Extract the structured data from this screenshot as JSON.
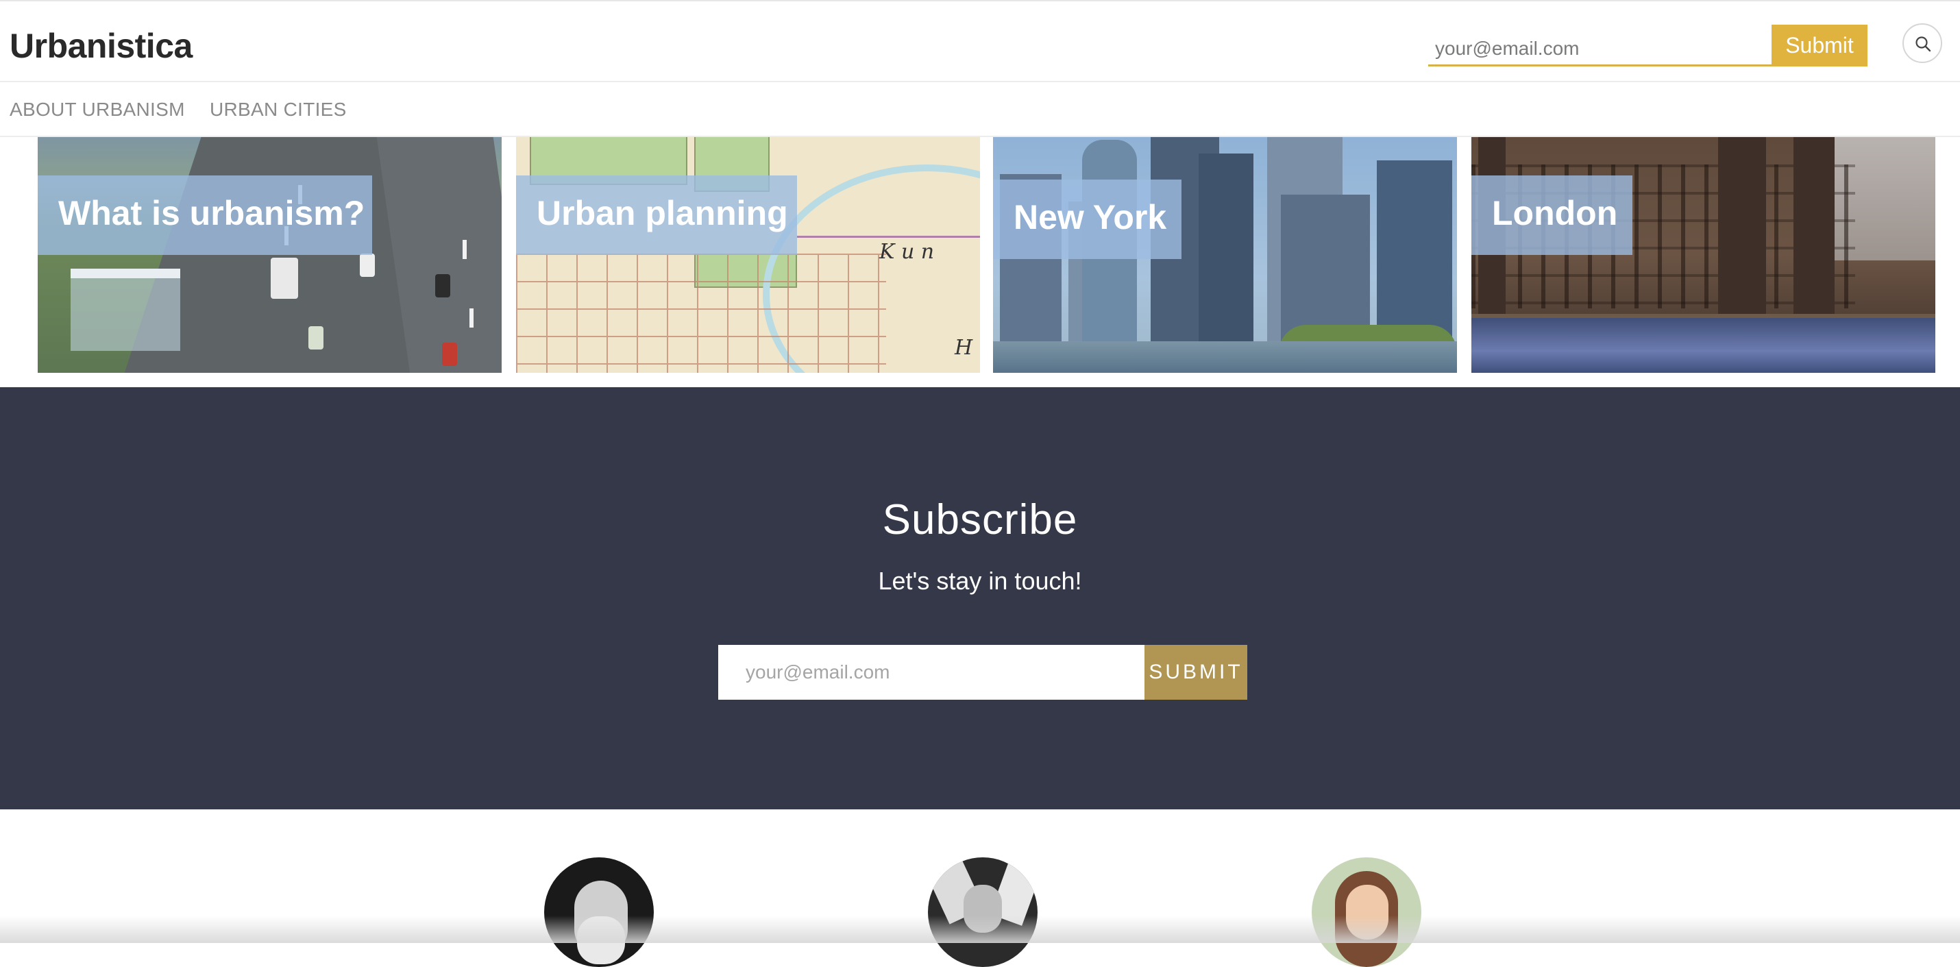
{
  "header": {
    "brand": "Urbanistica",
    "email_placeholder": "your@email.com",
    "submit_label": "Submit",
    "search_icon": "search-icon"
  },
  "nav": {
    "items": [
      {
        "label": "ABOUT URBANISM"
      },
      {
        "label": "URBAN CITIES"
      }
    ]
  },
  "cards": [
    {
      "title": "What is urbanism?"
    },
    {
      "title": "Urban planning"
    },
    {
      "title": "New York"
    },
    {
      "title": "London"
    }
  ],
  "subscribe": {
    "title": "Subscribe",
    "tagline": "Let's stay in touch!",
    "email_placeholder": "your@email.com",
    "submit_label": "SUBMIT"
  },
  "colors": {
    "accent": "#e0b33e",
    "subscribe_bg": "#353848",
    "subscribe_button": "#b09652",
    "card_ribbon": "#9cbce1"
  }
}
